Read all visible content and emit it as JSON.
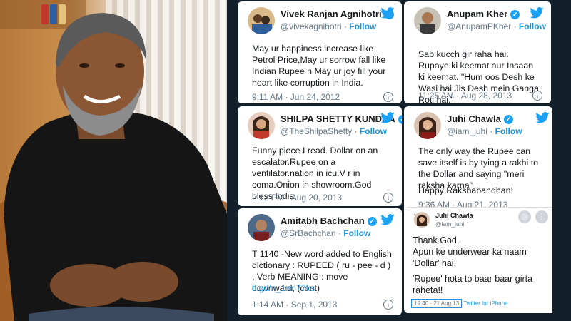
{
  "tweets": [
    {
      "name": "Vivek Ranjan Agnihotri",
      "handle": "@vivekagnihotri",
      "follow": "Follow",
      "text": "May ur happiness increase like Petrol Price,May ur sorrow fall like Indian Rupee n May ur joy fill your heart like corruption in India.",
      "time": "9:11 AM · Jun 24, 2012"
    },
    {
      "name": "Anupam Kher",
      "handle": "@AnupamPKher",
      "follow": "Follow",
      "text": "Sab kucch gir raha hai. Rupaye ki keemat aur Insaan ki keemat. \"Hum oos Desh ke Wasi hai Jis Desh mein Ganga Roti hai.\"",
      "time": "11:25 AM · Aug 28, 2013"
    },
    {
      "name": "SHILPA SHETTY KUNDRA",
      "handle": "@TheShilpaShetty",
      "follow": "Follow",
      "text": "Funny piece I read. Dollar on an escalator.Rupee on a ventilator.nation in icu.V r in coma.Onion in showroom.God bless India.",
      "time": "2:12 PM · Aug 20, 2013"
    },
    {
      "name": "Juhi Chawla",
      "handle": "@iam_juhi",
      "follow": "Follow",
      "text": "The only way the Rupee can save itself is by tying a rakhi to the Dollar and saying \"meri raksha karna\"",
      "text2": "Happy Rakshabandhan!",
      "time": "9:36 AM · Aug 21, 2013"
    },
    {
      "name": "Amitabh Bachchan",
      "handle": "@SrBachchan",
      "follow": "Follow",
      "text": "T 1140 -New word added to English dictionary : RUPEED ( ru - pee - d ) , Verb MEANING : move downward, (cont)",
      "link": "tl.gd/n_1rm77ks",
      "time": "1:14 AM · Sep 1, 2013"
    }
  ],
  "juhi_screenshot": {
    "name": "Juhi Chawla",
    "handle": "@iam_juhi",
    "line1": "Thank God,",
    "line2": "Apun ke underwear ka naam 'Dollar' hai.",
    "line3": "'Rupee' hota to baar baar girta raheta!!",
    "meta_box": "19:40 · 21 Aug 13",
    "meta_source": "Twitter for iPhone"
  },
  "colors": {
    "twitter_blue": "#1da1f2",
    "follow_blue": "#1b95e0",
    "muted": "#657786"
  },
  "icons": [
    "twitter-bird-icon",
    "verified-badge-icon",
    "info-icon"
  ]
}
